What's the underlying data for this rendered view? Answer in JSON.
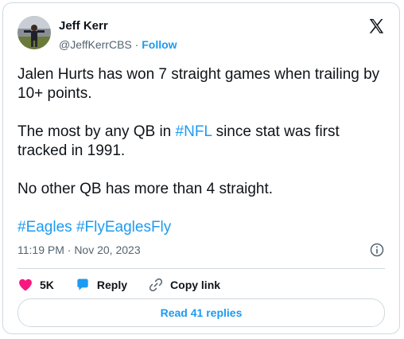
{
  "author": {
    "name": "Jeff Kerr",
    "handle": "@JeffKerrCBS",
    "separator": "·",
    "follow_label": "Follow"
  },
  "tweet": {
    "line1_text": "Jalen Hurts has won 7 straight games when trailing by 10+ points.",
    "line2_before": "The most by any QB in ",
    "line2_hashtag": "#NFL",
    "line2_after": " since stat was first tracked in 1991.",
    "line3_text": "No other QB has more than 4 straight.",
    "hashtag1": "#Eagles",
    "hashtag_space": " ",
    "hashtag2": "#FlyEaglesFly"
  },
  "meta": {
    "timestamp": "11:19 PM · Nov 20, 2023"
  },
  "actions": {
    "likes_count": "5K",
    "reply_label": "Reply",
    "copy_link_label": "Copy link"
  },
  "footer": {
    "read_replies_label": "Read 41 replies"
  },
  "colors": {
    "accent": "#1d9bf0",
    "like": "#f91880",
    "text": "#0f1419",
    "muted": "#536471",
    "border": "#cfd9de"
  },
  "icons": [
    "x-logo-icon",
    "info-icon",
    "heart-icon",
    "reply-bubble-icon",
    "link-icon"
  ]
}
